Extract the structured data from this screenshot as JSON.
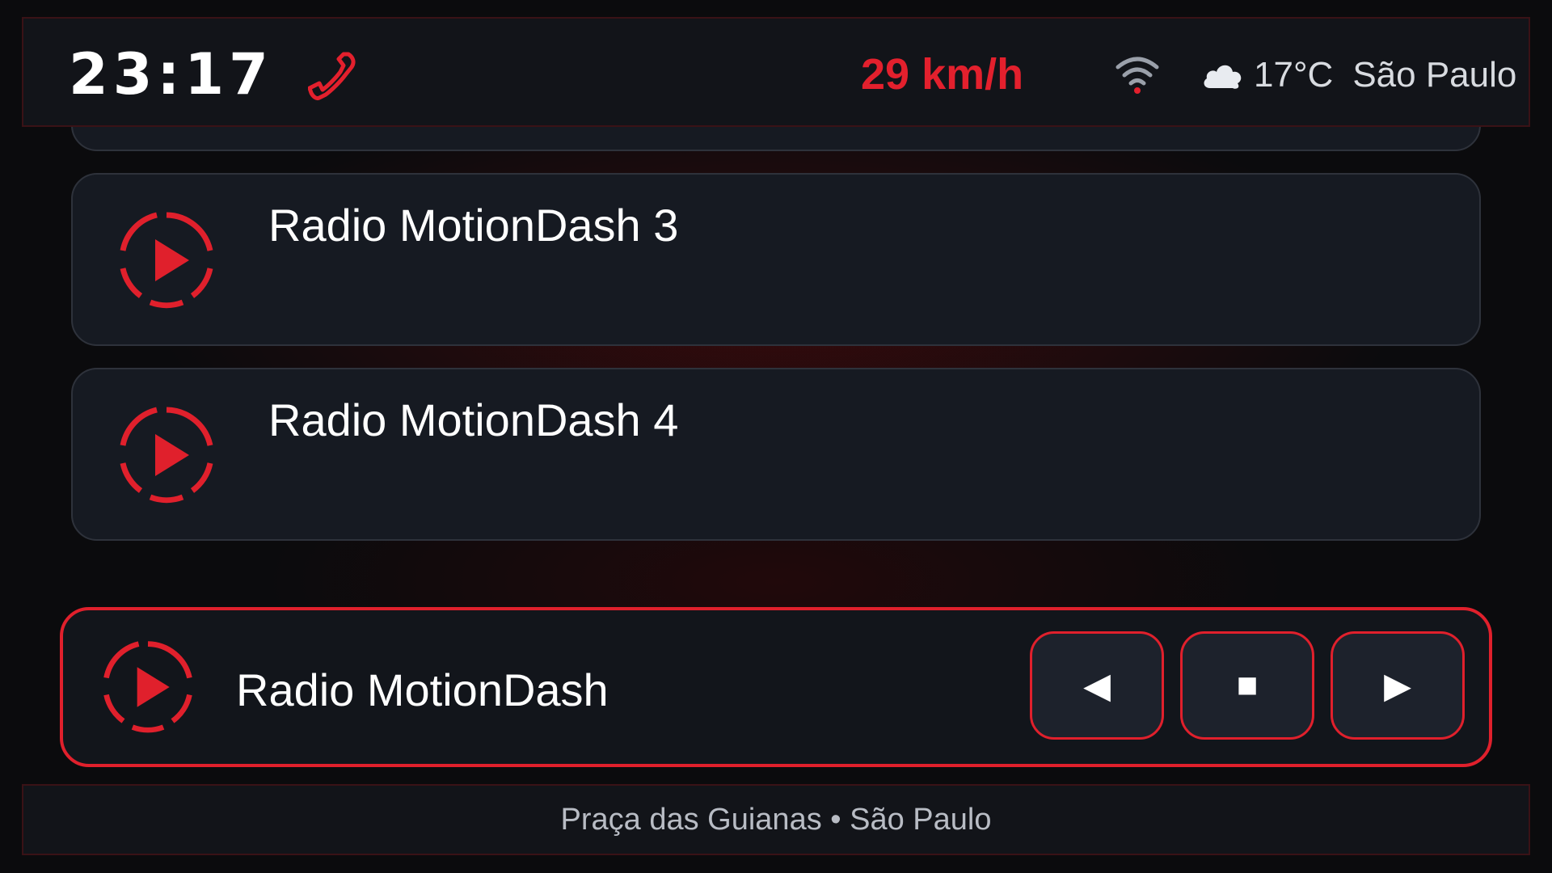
{
  "status": {
    "time": "23:17",
    "speed": "29 km/h",
    "temperature": "17°C",
    "city": "São Paulo",
    "phone_icon": "phone-icon",
    "wifi_icon": "wifi-icon",
    "weather_icon": "cloud-icon"
  },
  "stations": [
    {
      "title": "Radio MotionDash 3",
      "icon": "play-icon"
    },
    {
      "title": "Radio MotionDash 4",
      "icon": "play-icon"
    }
  ],
  "now_playing": {
    "title": "Radio MotionDash",
    "controls": {
      "prev": "◀",
      "stop": "■",
      "next": "▶"
    }
  },
  "footer": {
    "location": "Praça das Guianas • São Paulo"
  },
  "colors": {
    "accent": "#e0202c",
    "card_bg": "#161a22",
    "bar_bg": "#121419"
  }
}
